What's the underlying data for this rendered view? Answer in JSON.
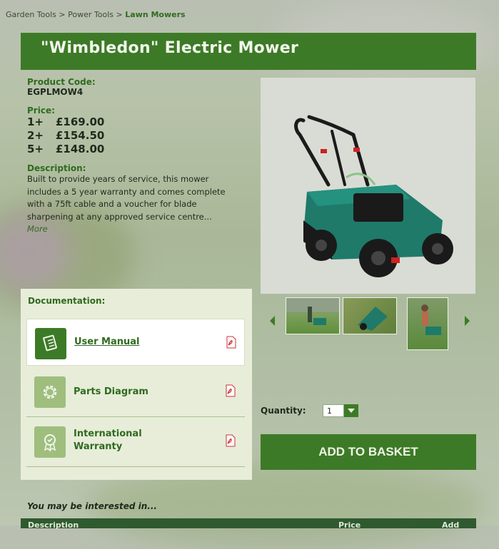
{
  "breadcrumb": {
    "items": [
      "Garden Tools",
      "Power Tools"
    ],
    "separator": ">",
    "current": "Lawn Mowers"
  },
  "product": {
    "title": "\"Wimbledon\" Electric Mower",
    "code_label": "Product Code:",
    "code": "EGPLMOW4",
    "price_label": "Price:",
    "prices": [
      {
        "qty": "1+",
        "price": "£169.00"
      },
      {
        "qty": "2+",
        "price": "£154.50"
      },
      {
        "qty": "5+",
        "price": "£148.00"
      }
    ],
    "description_label": "Description:",
    "description": "Built to provide years of service, this mower includes a 5 year warranty and comes complete with a 75ft cable and a voucher for blade sharpening at any approved service centre...",
    "more_link": "More"
  },
  "documentation": {
    "heading": "Documentation:",
    "items": [
      {
        "label": "User Manual",
        "icon": "manual-icon"
      },
      {
        "label": "Parts Diagram",
        "icon": "gear-icon"
      },
      {
        "label": "International Warranty",
        "icon": "award-icon"
      }
    ]
  },
  "gallery": {
    "thumbnails": [
      "mower-garden-thumb",
      "mower-closeup-thumb",
      "woman-mowing-thumb"
    ]
  },
  "purchase": {
    "quantity_label": "Quantity:",
    "quantity_value": "1",
    "add_button": "ADD TO BASKET"
  },
  "related": {
    "heading": "You may be interested in...",
    "columns": [
      "Description",
      "Price",
      "Add"
    ]
  },
  "colors": {
    "brand_green": "#3d7a27",
    "dark_green": "#2f6b1f",
    "panel": "#e7edd9"
  }
}
